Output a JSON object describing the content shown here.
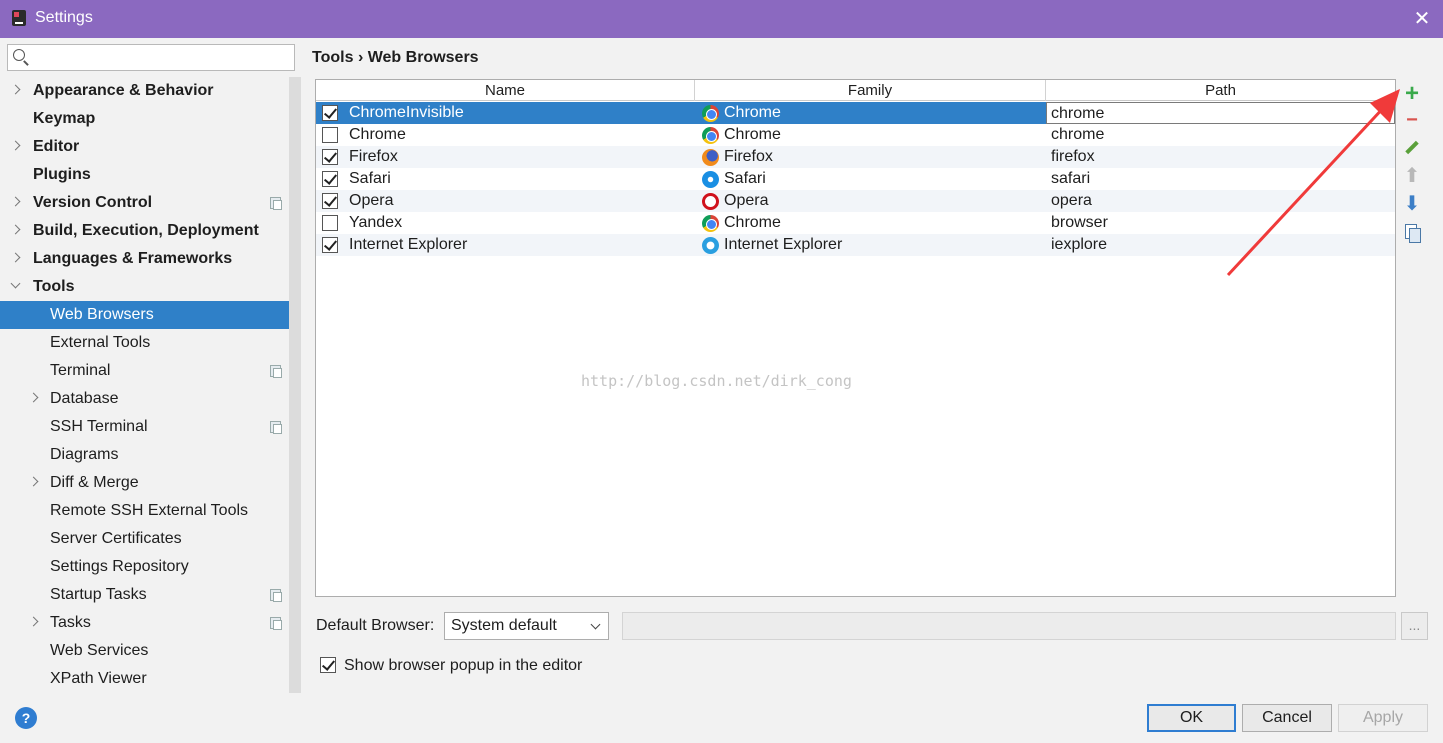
{
  "window": {
    "title": "Settings",
    "close_glyph": "✕"
  },
  "search": {
    "placeholder": "",
    "value": ""
  },
  "tree": [
    {
      "label": "Appearance & Behavior",
      "bold": true,
      "arrow": "collapsed",
      "indent": 0,
      "project_icon": false,
      "selected": false
    },
    {
      "label": "Keymap",
      "bold": true,
      "arrow": "none",
      "indent": 0,
      "project_icon": false,
      "selected": false
    },
    {
      "label": "Editor",
      "bold": true,
      "arrow": "collapsed",
      "indent": 0,
      "project_icon": false,
      "selected": false
    },
    {
      "label": "Plugins",
      "bold": true,
      "arrow": "none",
      "indent": 0,
      "project_icon": false,
      "selected": false
    },
    {
      "label": "Version Control",
      "bold": true,
      "arrow": "collapsed",
      "indent": 0,
      "project_icon": true,
      "selected": false
    },
    {
      "label": "Build, Execution, Deployment",
      "bold": true,
      "arrow": "collapsed",
      "indent": 0,
      "project_icon": false,
      "selected": false
    },
    {
      "label": "Languages & Frameworks",
      "bold": true,
      "arrow": "collapsed",
      "indent": 0,
      "project_icon": false,
      "selected": false
    },
    {
      "label": "Tools",
      "bold": true,
      "arrow": "expanded",
      "indent": 0,
      "project_icon": false,
      "selected": false
    },
    {
      "label": "Web Browsers",
      "bold": false,
      "arrow": "none",
      "indent": 1,
      "project_icon": false,
      "selected": true
    },
    {
      "label": "External Tools",
      "bold": false,
      "arrow": "none",
      "indent": 1,
      "project_icon": false,
      "selected": false
    },
    {
      "label": "Terminal",
      "bold": false,
      "arrow": "none",
      "indent": 1,
      "project_icon": true,
      "selected": false
    },
    {
      "label": "Database",
      "bold": false,
      "arrow": "collapsed",
      "indent": 1,
      "project_icon": false,
      "selected": false
    },
    {
      "label": "SSH Terminal",
      "bold": false,
      "arrow": "none",
      "indent": 1,
      "project_icon": true,
      "selected": false
    },
    {
      "label": "Diagrams",
      "bold": false,
      "arrow": "none",
      "indent": 1,
      "project_icon": false,
      "selected": false
    },
    {
      "label": "Diff & Merge",
      "bold": false,
      "arrow": "collapsed",
      "indent": 1,
      "project_icon": false,
      "selected": false
    },
    {
      "label": "Remote SSH External Tools",
      "bold": false,
      "arrow": "none",
      "indent": 1,
      "project_icon": false,
      "selected": false
    },
    {
      "label": "Server Certificates",
      "bold": false,
      "arrow": "none",
      "indent": 1,
      "project_icon": false,
      "selected": false
    },
    {
      "label": "Settings Repository",
      "bold": false,
      "arrow": "none",
      "indent": 1,
      "project_icon": false,
      "selected": false
    },
    {
      "label": "Startup Tasks",
      "bold": false,
      "arrow": "none",
      "indent": 1,
      "project_icon": true,
      "selected": false
    },
    {
      "label": "Tasks",
      "bold": false,
      "arrow": "collapsed",
      "indent": 1,
      "project_icon": true,
      "selected": false
    },
    {
      "label": "Web Services",
      "bold": false,
      "arrow": "none",
      "indent": 1,
      "project_icon": false,
      "selected": false
    },
    {
      "label": "XPath Viewer",
      "bold": false,
      "arrow": "none",
      "indent": 1,
      "project_icon": false,
      "selected": false
    }
  ],
  "breadcrumb": {
    "parent": "Tools",
    "separator": "›",
    "current": "Web Browsers"
  },
  "table": {
    "columns": [
      "Name",
      "Family",
      "Path"
    ],
    "rows": [
      {
        "checked": true,
        "name": "ChromeInvisible",
        "family": "Chrome",
        "family_icon": "chrome-icon",
        "path": "chrome",
        "selected": true
      },
      {
        "checked": false,
        "name": "Chrome",
        "family": "Chrome",
        "family_icon": "chrome-icon",
        "path": "chrome",
        "selected": false
      },
      {
        "checked": true,
        "name": "Firefox",
        "family": "Firefox",
        "family_icon": "firefox-icon",
        "path": "firefox",
        "selected": false
      },
      {
        "checked": true,
        "name": "Safari",
        "family": "Safari",
        "family_icon": "safari-icon",
        "path": "safari",
        "selected": false
      },
      {
        "checked": true,
        "name": "Opera",
        "family": "Opera",
        "family_icon": "opera-icon",
        "path": "opera",
        "selected": false
      },
      {
        "checked": false,
        "name": "Yandex",
        "family": "Chrome",
        "family_icon": "chrome-icon",
        "path": "browser",
        "selected": false
      },
      {
        "checked": true,
        "name": "Internet Explorer",
        "family": "Internet Explorer",
        "family_icon": "ie-icon",
        "path": "iexplore",
        "selected": false
      }
    ]
  },
  "toolbar": {
    "add_glyph": "+",
    "remove_glyph": "−",
    "up_glyph": "⬆",
    "down_glyph": "⬇"
  },
  "watermark": "http://blog.csdn.net/dirk_cong",
  "default_browser": {
    "label": "Default Browser:",
    "selected": "System default",
    "path_value": "",
    "browse_label": "..."
  },
  "popup_option": {
    "label": "Show browser popup in the editor",
    "checked": true
  },
  "help": {
    "glyph": "?"
  },
  "buttons": {
    "ok": "OK",
    "cancel": "Cancel",
    "apply": "Apply"
  },
  "colors": {
    "titlebar": "#8b69c0",
    "selection": "#2f80c8",
    "annotation_arrow": "#f03a3a",
    "add_green": "#39a94b",
    "remove_red": "#d9544f"
  }
}
